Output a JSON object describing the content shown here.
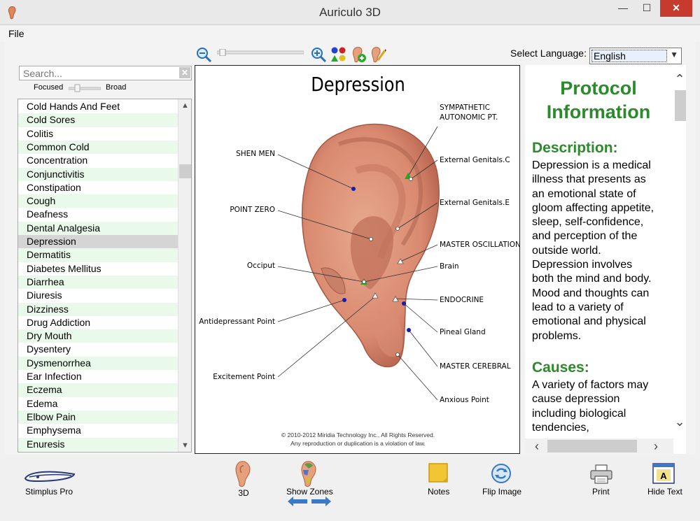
{
  "window": {
    "title": "Auriculo 3D",
    "minimize": "—",
    "maximize": "☐",
    "close": "✕"
  },
  "menu": {
    "file": "File"
  },
  "language": {
    "label": "Select Language:",
    "value": "English"
  },
  "search": {
    "placeholder": "Search...",
    "focused_label": "Focused",
    "broad_label": "Broad"
  },
  "conditions": [
    "Cold Hands And Feet",
    "Cold Sores",
    "Colitis",
    "Common Cold",
    "Concentration",
    "Conjunctivitis",
    "Constipation",
    "Cough",
    "Deafness",
    "Dental Analgesia",
    "Depression",
    "Dermatitis",
    "Diabetes Mellitus",
    "Diarrhea",
    "Diuresis",
    "Dizziness",
    "Drug Addiction",
    "Dry Mouth",
    "Dysentery",
    "Dysmenorrhea",
    "Ear Infection",
    "Eczema",
    "Edema",
    "Elbow Pain",
    "Emphysema",
    "Enuresis"
  ],
  "selected_condition": "Depression",
  "image": {
    "title": "Depression",
    "labels_left": [
      "SHEN MEN",
      "POINT ZERO",
      "Occiput",
      "Antidepressant Point",
      "Excitement Point"
    ],
    "labels_right": [
      "SYMPATHETIC",
      "AUTONOMIC PT.",
      "External Genitals.C",
      "External Genitals.E",
      "MASTER OSCILLATION",
      "Brain",
      "ENDOCRINE",
      "Pineal Gland",
      "MASTER CEREBRAL",
      "Anxious Point"
    ],
    "copyright_1": "© 2010-2012 Miridia Technology Inc., All Rights Reserved.",
    "copyright_2": "Any reproduction or duplication is a violation of law."
  },
  "protocol": {
    "title_1": "Protocol",
    "title_2": "Information",
    "description_heading": "Description:",
    "description_lines": [
      "Depression is a medical",
      "illness that presents as",
      "an emotional state of",
      "gloom affecting appetite,",
      "sleep, self-confidence,",
      "and perception of the",
      "outside world.",
      "Depression involves",
      "both the mind and body.",
      "Mood and thoughts can",
      "lead to a variety of",
      "emotional and physical",
      "problems."
    ],
    "causes_heading": "Causes:",
    "causes_lines": [
      "A variety of factors may",
      "cause depression",
      "including biological",
      "tendencies,"
    ]
  },
  "bottom_toolbar": {
    "stimplus": "Stimplus Pro",
    "three_d": "3D",
    "show_zones": "Show Zones",
    "notes": "Notes",
    "flip_image": "Flip Image",
    "print": "Print",
    "hide_text": "Hide Text"
  },
  "colors": {
    "accent_green": "#2b8a2b",
    "list_alt_row": "#eafaea",
    "list_selected": "#d5d5d5",
    "close_red": "#c73b2e",
    "point_blue": "#1a1ab0",
    "point_green": "#22aa22"
  }
}
